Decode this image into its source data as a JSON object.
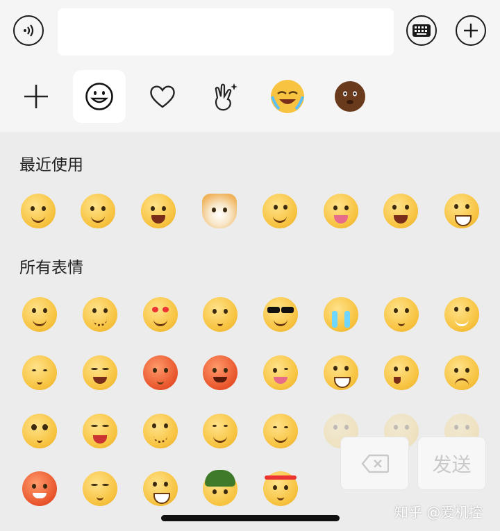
{
  "input": {
    "value": "",
    "placeholder": ""
  },
  "topbar": {
    "voice_icon": "voice-icon",
    "keyboard_icon": "keyboard-icon",
    "more_icon": "plus-icon"
  },
  "tabs": [
    {
      "icon": "add-icon"
    },
    {
      "icon": "smiley-icon",
      "active": true
    },
    {
      "icon": "heart-icon"
    },
    {
      "icon": "hand-sparkle-icon"
    },
    {
      "icon": "laughing-emoji-icon"
    },
    {
      "icon": "brown-emoji-icon"
    }
  ],
  "sections": {
    "recent_title": "最近使用",
    "all_title": "所有表情"
  },
  "buttons": {
    "send_label": "发送",
    "delete_icon": "backspace-icon"
  },
  "watermark": "知乎 @爱机控",
  "colors": {
    "emoji_yellow": "#f7c340",
    "panel_bg": "#ececec",
    "button_text_disabled": "#c9c9c9"
  }
}
